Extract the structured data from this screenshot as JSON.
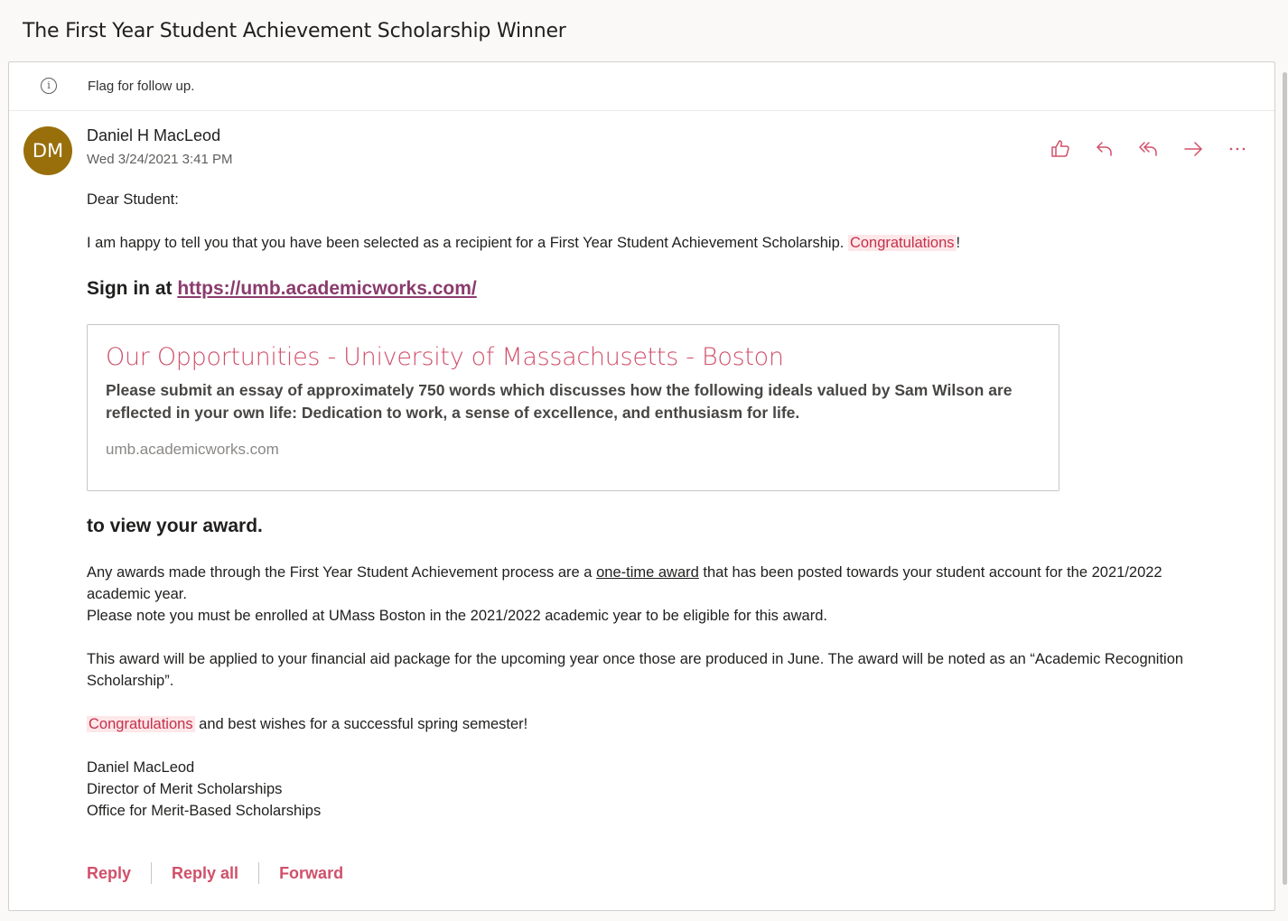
{
  "subject": "The First Year Student Achievement Scholarship Winner",
  "infobar": {
    "text": "Flag for follow up.",
    "icon": "info-icon"
  },
  "sender": {
    "initials": "DM",
    "name": "Daniel H MacLeod",
    "date": "Wed 3/24/2021 3:41 PM",
    "avatar_color": "#986f0b"
  },
  "actions": [
    "like-icon",
    "reply-icon",
    "reply-all-icon",
    "forward-icon",
    "more-icon"
  ],
  "accent_color": "#d0506a",
  "body": {
    "greeting": "Dear Student:",
    "line1": "I am happy to tell you that you have been selected as a recipient for a First Year Student Achievement Scholarship.",
    "congrats": "Congratulations",
    "exclaim": "!",
    "signin_prefix": "Sign in at",
    "signin_link": "https://umb.academicworks.com/",
    "preview": {
      "title": "Our Opportunities - University of Massachusetts - Boston",
      "description": "Please submit an essay of approximately 750 words which discusses how the following ideals valued by Sam Wilson are reflected in your own life: Dedication to work, a sense of excellence, and enthusiasm for life.",
      "domain": "umb.academicworks.com"
    },
    "view_award": "to view your award.",
    "para2_a": "Any awards made through the First Year Student Achievement process are a",
    "para2_ul": "one-time award",
    "para2_b": "that has been posted towards your student account for the 2021/2022 academic year.",
    "para2_c": "Please note you must be enrolled at UMass Boston in the 2021/2022 academic year to be eligible for this award.",
    "para3": "This award will be applied to your financial aid package for the upcoming year once those are produced in June. The award will be noted as an “Academic Recognition Scholarship”.",
    "para4_rest": "and best wishes for a successful spring semester!",
    "sig1": "Daniel MacLeod",
    "sig2": "Director of Merit Scholarships",
    "sig3": "Office for Merit-Based Scholarships"
  },
  "footer": {
    "reply": "Reply",
    "reply_all": "Reply all",
    "forward": "Forward"
  }
}
